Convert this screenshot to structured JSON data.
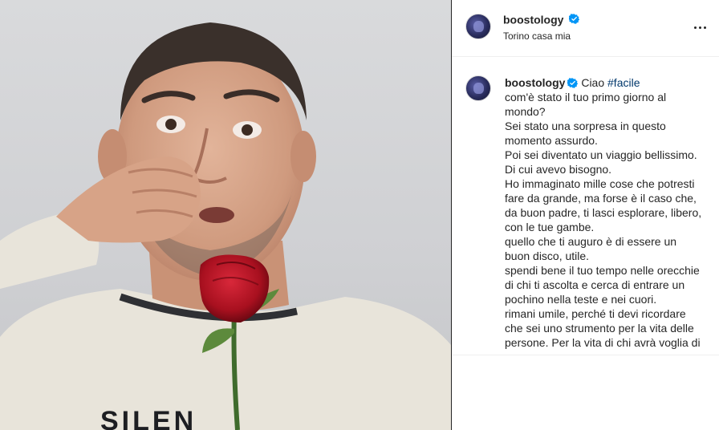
{
  "post": {
    "username": "boostology",
    "location": "Torino casa mia",
    "verified": true,
    "caption": {
      "opening": "Ciao",
      "hashtag": "#facile",
      "lines": [
        "com'è stato il tuo primo giorno al",
        "mondo?",
        "Sei stato una sorpresa in questo",
        "momento assurdo.",
        "Poi sei diventato un viaggio bellissimo.",
        "Di cui avevo bisogno.",
        "Ho immaginato mille cose che potresti",
        "fare da grande, ma forse è il caso che,",
        "da buon padre, ti lasci esplorare, libero,",
        "con le tue gambe.",
        "quello che ti auguro è di essere un",
        "buon disco, utile.",
        "spendi bene il tuo tempo nelle orecchie",
        "di chi ti ascolta e cerca di entrare un",
        "pochino nella teste e nei cuori.",
        "rimani umile, perché ti devi ricordare",
        "che sei uno strumento per la vita delle",
        "persone. Per la vita di chi avrà voglia di"
      ]
    },
    "photo_sweater_text": "SILEN"
  },
  "icons": {
    "verified": "verified-badge-icon",
    "more": "more-options-icon"
  },
  "colors": {
    "verified_blue": "#0095f6",
    "hashtag_blue": "#00376b",
    "text": "#262626",
    "rose_red": "#b3121f"
  }
}
